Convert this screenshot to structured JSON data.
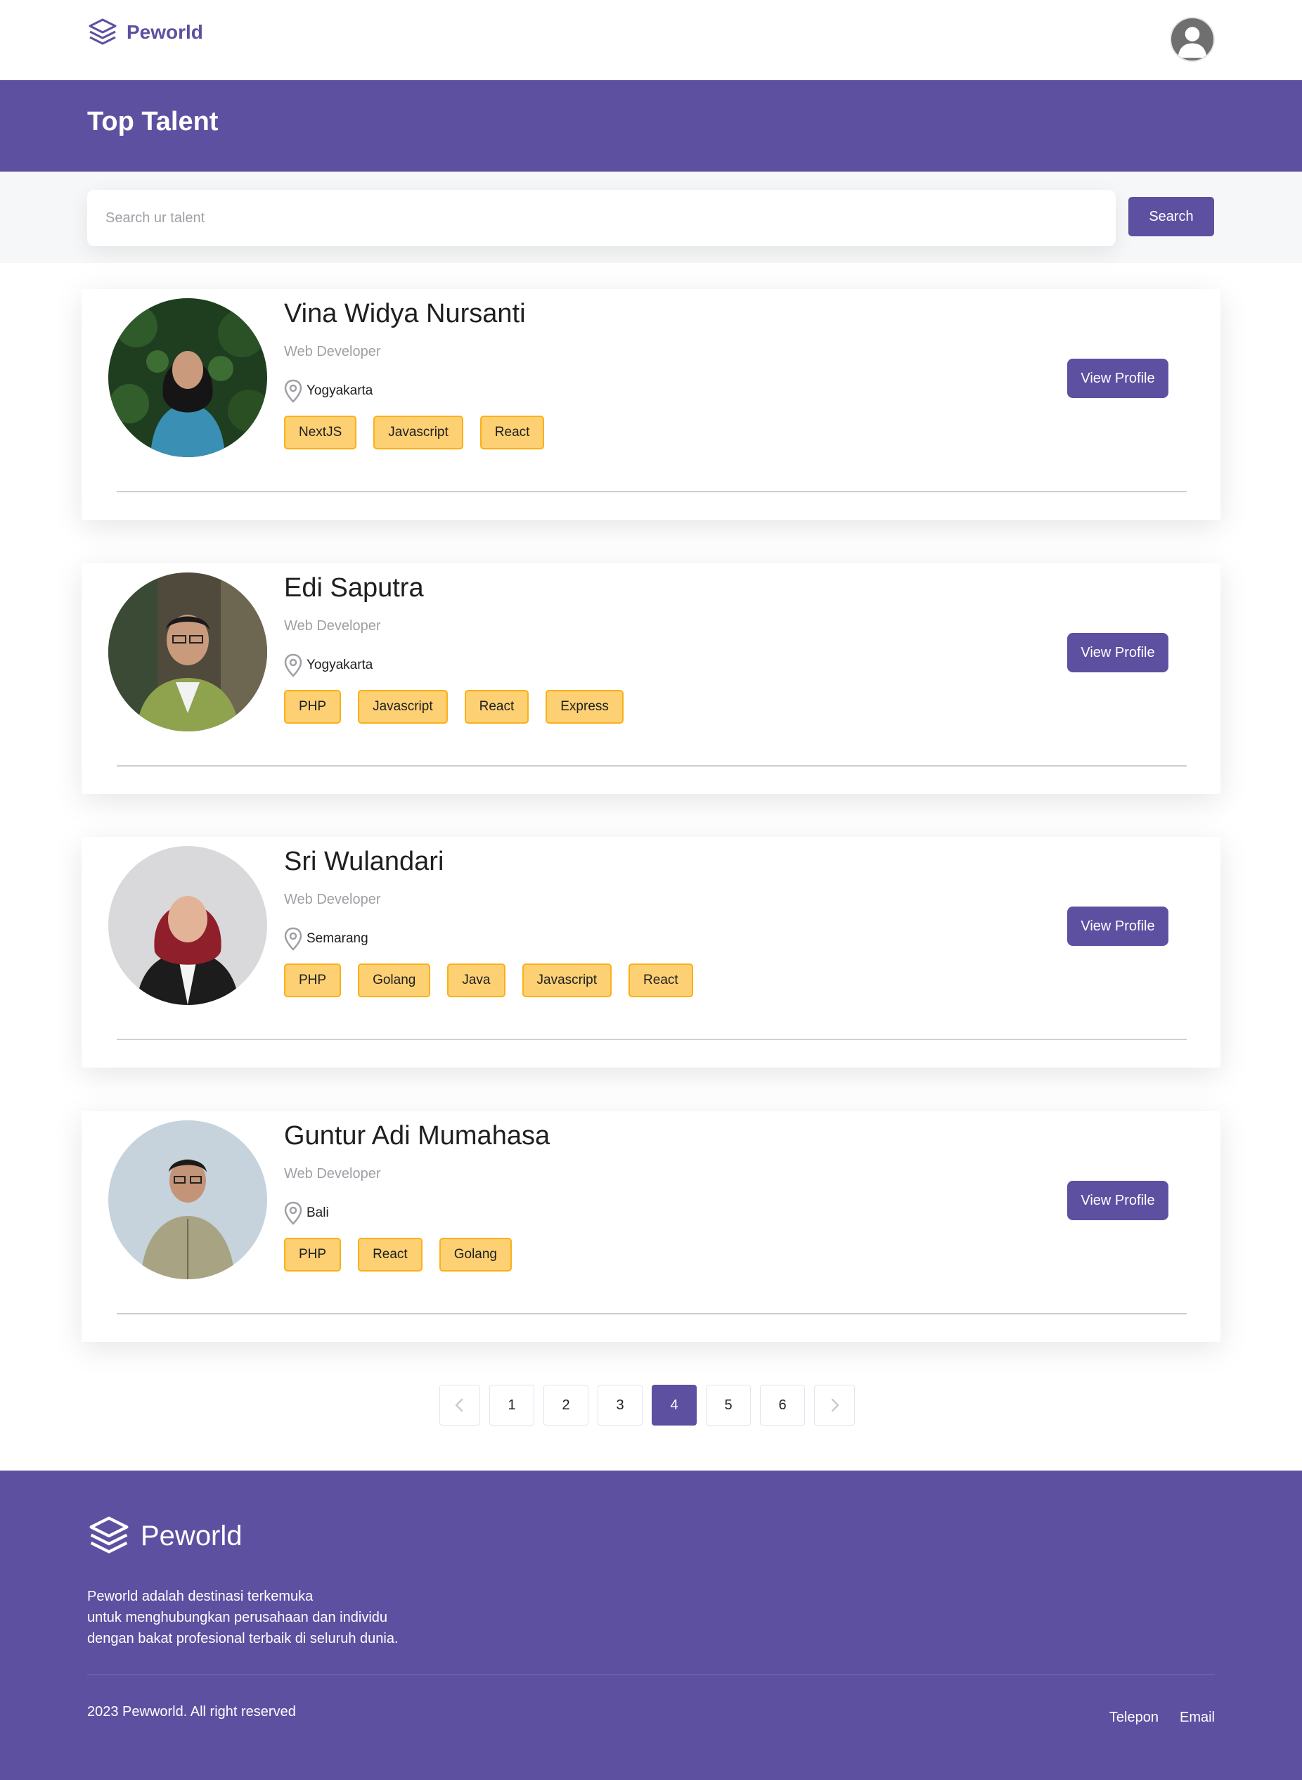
{
  "nav": {
    "brand": "Peworld",
    "logo_icon": "layers-icon",
    "avatar_icon": "user-avatar-icon"
  },
  "header": {
    "title": "Top Talent"
  },
  "search": {
    "placeholder": "Search ur talent",
    "button_label": "Search"
  },
  "talents": [
    {
      "name": "Vina Widya Nursanti",
      "job": "Web Developer",
      "location": "Yogyakarta",
      "skills": [
        "NextJS",
        "Javascript",
        "React"
      ],
      "button_label": "View Profile"
    },
    {
      "name": "Edi Saputra",
      "job": "Web Developer",
      "location": "Yogyakarta",
      "skills": [
        "PHP",
        "Javascript",
        "React",
        "Express"
      ],
      "button_label": "View Profile"
    },
    {
      "name": "Sri Wulandari",
      "job": "Web Developer",
      "location": "Semarang",
      "skills": [
        "PHP",
        "Golang",
        "Java",
        "Javascript",
        "React"
      ],
      "button_label": "View Profile"
    },
    {
      "name": "Guntur Adi Mumahasa",
      "job": "Web Developer",
      "location": "Bali",
      "skills": [
        "PHP",
        "React",
        "Golang"
      ],
      "button_label": "View Profile"
    }
  ],
  "pagination": {
    "pages": [
      "1",
      "2",
      "3",
      "4",
      "5",
      "6"
    ],
    "current": "4",
    "prev_icon": "chevron-left-icon",
    "next_icon": "chevron-right-icon"
  },
  "footer": {
    "brand": "Peworld",
    "description_lines": [
      "Peworld adalah destinasi terkemuka",
      "untuk menghubungkan perusahaan dan individu",
      "dengan bakat profesional terbaik di seluruh dunia."
    ],
    "copyright": "2023 Pewworld. All right reserved",
    "links": [
      "Telepon",
      "Email"
    ]
  },
  "colors": {
    "primary": "#5e50a1",
    "skill_bg": "#fdd074",
    "skill_border": "#fbb017",
    "muted": "#9ea0a5"
  }
}
